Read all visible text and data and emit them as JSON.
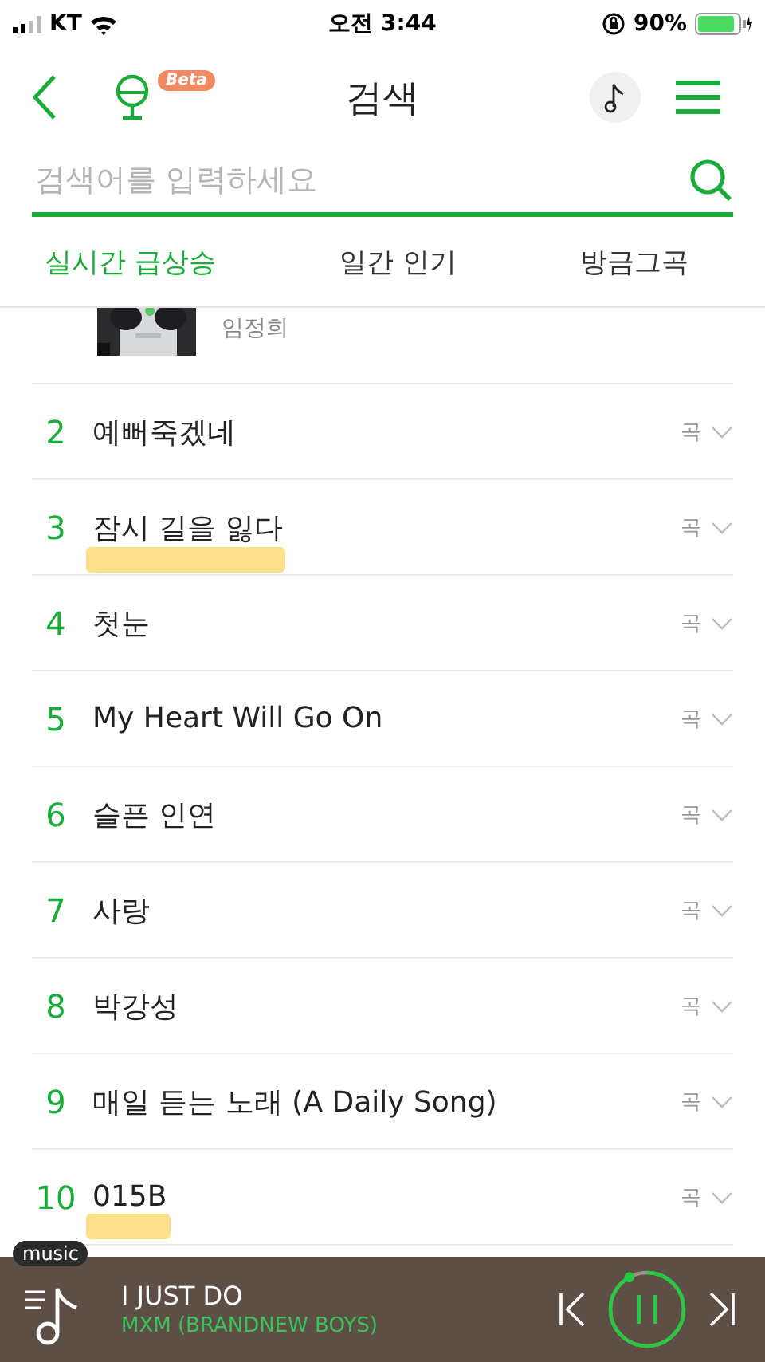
{
  "status_bar": {
    "carrier": "KT",
    "time": "오전 3:44",
    "battery": "90%"
  },
  "header": {
    "title": "검색",
    "badge": "Beta"
  },
  "search": {
    "placeholder": "검색어를 입력하세요"
  },
  "tabs": [
    {
      "label": "실시간 급상승",
      "selected": true
    },
    {
      "label": "일간 인기",
      "selected": false
    },
    {
      "label": "방금그곡",
      "selected": false
    }
  ],
  "partial_row": {
    "artist": "임정희"
  },
  "rows": [
    {
      "rank": "2",
      "title": "예뻐죽겠네",
      "type": "곡",
      "highlighted": false
    },
    {
      "rank": "3",
      "title": "잠시 길을 잃다",
      "type": "곡",
      "highlighted": true
    },
    {
      "rank": "4",
      "title": "첫눈",
      "type": "곡",
      "highlighted": false
    },
    {
      "rank": "5",
      "title": "My Heart Will Go On",
      "type": "곡",
      "highlighted": false
    },
    {
      "rank": "6",
      "title": "슬픈 인연",
      "type": "곡",
      "highlighted": false
    },
    {
      "rank": "7",
      "title": "사랑",
      "type": "곡",
      "highlighted": false
    },
    {
      "rank": "8",
      "title": "박강성",
      "type": "곡",
      "highlighted": false
    },
    {
      "rank": "9",
      "title": "매일 듣는 노래 (A Daily Song)",
      "type": "곡",
      "highlighted": false
    },
    {
      "rank": "10",
      "title": "015B",
      "type": "곡",
      "highlighted": true
    }
  ],
  "player": {
    "badge": "music",
    "title": "I JUST DO",
    "artist": "MXM (BRANDNEW BOYS)",
    "playing": true,
    "level": 0.92
  }
}
